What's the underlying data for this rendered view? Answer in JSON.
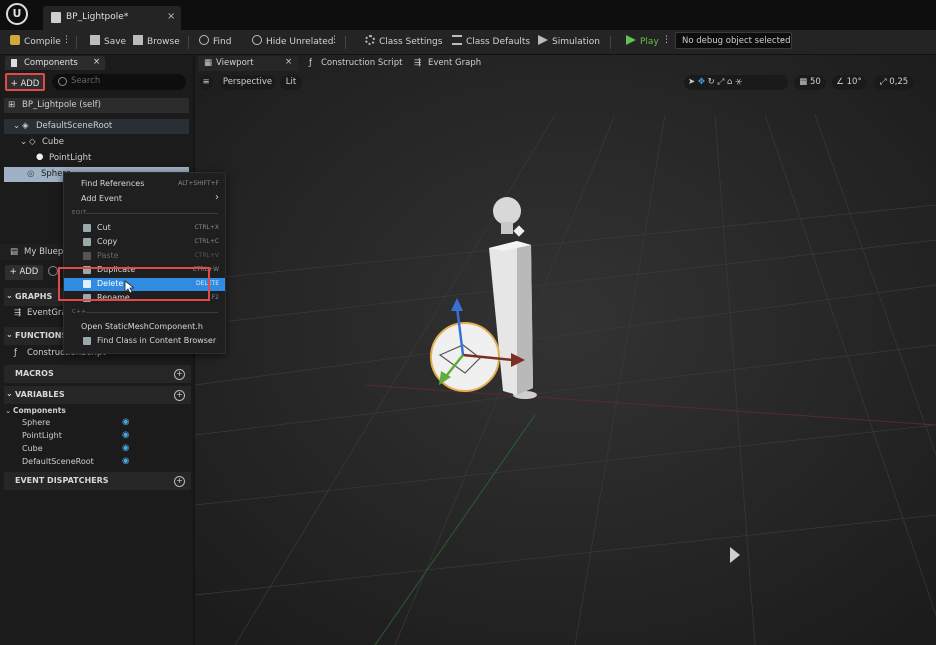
{
  "titlebar": {
    "logo": "U",
    "doc_tab": "BP_Lightpole*",
    "close": "×"
  },
  "toolbar": {
    "compile": "Compile",
    "save": "Save",
    "browse": "Browse",
    "find": "Find",
    "hide_unrelated": "Hide Unrelated",
    "class_settings": "Class Settings",
    "class_defaults": "Class Defaults",
    "simulation": "Simulation",
    "play": "Play",
    "debug_select": "No debug object selected",
    "kebab": "⋮",
    "chev": "⌄"
  },
  "components_panel": {
    "tab": "Components",
    "close": "×",
    "add": "+ ADD",
    "search_placeholder": "Search",
    "self_row": "BP_Lightpole (self)",
    "tree": [
      "DefaultSceneRoot",
      "Cube",
      "PointLight",
      "Sphere"
    ]
  },
  "my_blueprint": {
    "tab": "My Blueprint",
    "add": "+ ADD",
    "graphs": "GRAPHS",
    "graph_item": "EventGraph",
    "functions": "FUNCTIONS",
    "function_item": "ConstructionScript",
    "macros": "MACROS",
    "variables": "VARIABLES",
    "components_header": "Components",
    "variable_items": [
      "Sphere",
      "PointLight",
      "Cube",
      "DefaultSceneRoot"
    ],
    "event_dispatchers": "EVENT DISPATCHERS"
  },
  "viewport": {
    "tabs": [
      "Viewport",
      "Construction Script",
      "Event Graph"
    ],
    "perspective": "Perspective",
    "lit": "Lit",
    "menu": "≡",
    "grid_snap": "50",
    "rot_snap": "10°",
    "scale_snap": "0,25"
  },
  "context_menu": {
    "items": [
      {
        "label": "Find References",
        "shortcut": "ALT+SHIFT+F"
      },
      {
        "label": "Add Event",
        "shortcut": "›"
      }
    ],
    "edit_header": "EDIT",
    "edit_items": [
      {
        "label": "Cut",
        "shortcut": "CTRL+X"
      },
      {
        "label": "Copy",
        "shortcut": "CTRL+C"
      },
      {
        "label": "Paste",
        "shortcut": "CTRL+V"
      },
      {
        "label": "Duplicate",
        "shortcut": "CTRL+W"
      },
      {
        "label": "Delete",
        "shortcut": "DELETE"
      },
      {
        "label": "Rename",
        "shortcut": "F2"
      }
    ],
    "cpp_header": "C++",
    "cpp_items": [
      {
        "label": "Open StaticMeshComponent.h"
      },
      {
        "label": "Find Class in Content Browser"
      }
    ]
  },
  "colors": {
    "highlight": "#2f8ce0",
    "red_box": "#e04a4a",
    "play_green": "#62c050"
  }
}
